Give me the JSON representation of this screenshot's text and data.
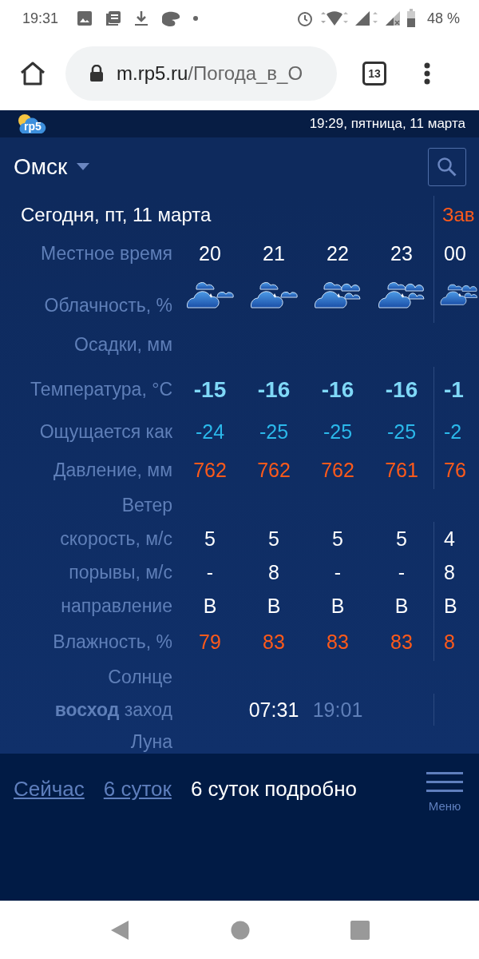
{
  "status_bar": {
    "time": "19:31",
    "battery": "48 %"
  },
  "browser": {
    "host": "m.rp5.ru",
    "path": "/Погода_в_О",
    "tab_count": "13"
  },
  "site_header": {
    "logo_text": "rp5",
    "datetime": "19:29, пятница, 11 марта"
  },
  "city": {
    "name": "Омск"
  },
  "forecast": {
    "today_title": "Сегодня, пт, 11 марта",
    "tomorrow_title": "Зав",
    "rows": [
      {
        "kind": "hours",
        "label": "Местное время",
        "cells": [
          "20",
          "21",
          "22",
          "23",
          "00"
        ]
      },
      {
        "kind": "clouds",
        "label": "Облачность, %",
        "cells": [
          {
            "kind": "few-clouds"
          },
          {
            "kind": "few-clouds"
          },
          {
            "kind": "many-clouds"
          },
          {
            "kind": "many-clouds"
          },
          {
            "kind": "many-clouds"
          }
        ]
      },
      {
        "kind": "precip",
        "label": "Осадки, мм",
        "cells": []
      },
      {
        "kind": "temp",
        "label": "Температура, °C",
        "cells": [
          "-15",
          "-16",
          "-16",
          "-16",
          "-1"
        ]
      },
      {
        "kind": "feels",
        "label": "Ощущается как",
        "cells": [
          "-24",
          "-25",
          "-25",
          "-25",
          "-2"
        ]
      },
      {
        "kind": "pressure",
        "label": "Давление, мм",
        "cells": [
          "762",
          "762",
          "762",
          "761",
          "76"
        ]
      },
      {
        "kind": "header",
        "label": "Ветер",
        "cells": []
      },
      {
        "kind": "plain",
        "label": "скорость, м/с",
        "cells": [
          "5",
          "5",
          "5",
          "5",
          "4"
        ]
      },
      {
        "kind": "plain",
        "label": "порывы, м/с",
        "cells": [
          "-",
          "8",
          "-",
          "-",
          "8"
        ]
      },
      {
        "kind": "plain",
        "label": "направление",
        "cells": [
          "В",
          "В",
          "В",
          "В",
          "В"
        ]
      },
      {
        "kind": "humidity",
        "label": "Влажность, %",
        "cells": [
          "79",
          "83",
          "83",
          "83",
          "8"
        ]
      },
      {
        "kind": "header",
        "label": "Солнце",
        "cells": []
      },
      {
        "kind": "sun",
        "label": "**восход** заход",
        "cells": [
          {
            "kind": "blank"
          },
          {
            "kind": "rise",
            "text": "07:31"
          },
          {
            "kind": "set",
            "text": "19:01"
          },
          {
            "kind": "blank"
          },
          {
            "kind": "blank"
          }
        ]
      },
      {
        "kind": "header",
        "label": "Луна",
        "cells": []
      }
    ]
  },
  "bottom_nav": {
    "tabs": [
      {
        "label": "Сейчас",
        "selected": false
      },
      {
        "label": "6 суток",
        "selected": false
      },
      {
        "label": "6 суток подробно",
        "selected": true
      }
    ],
    "menu_label": "Меню"
  }
}
